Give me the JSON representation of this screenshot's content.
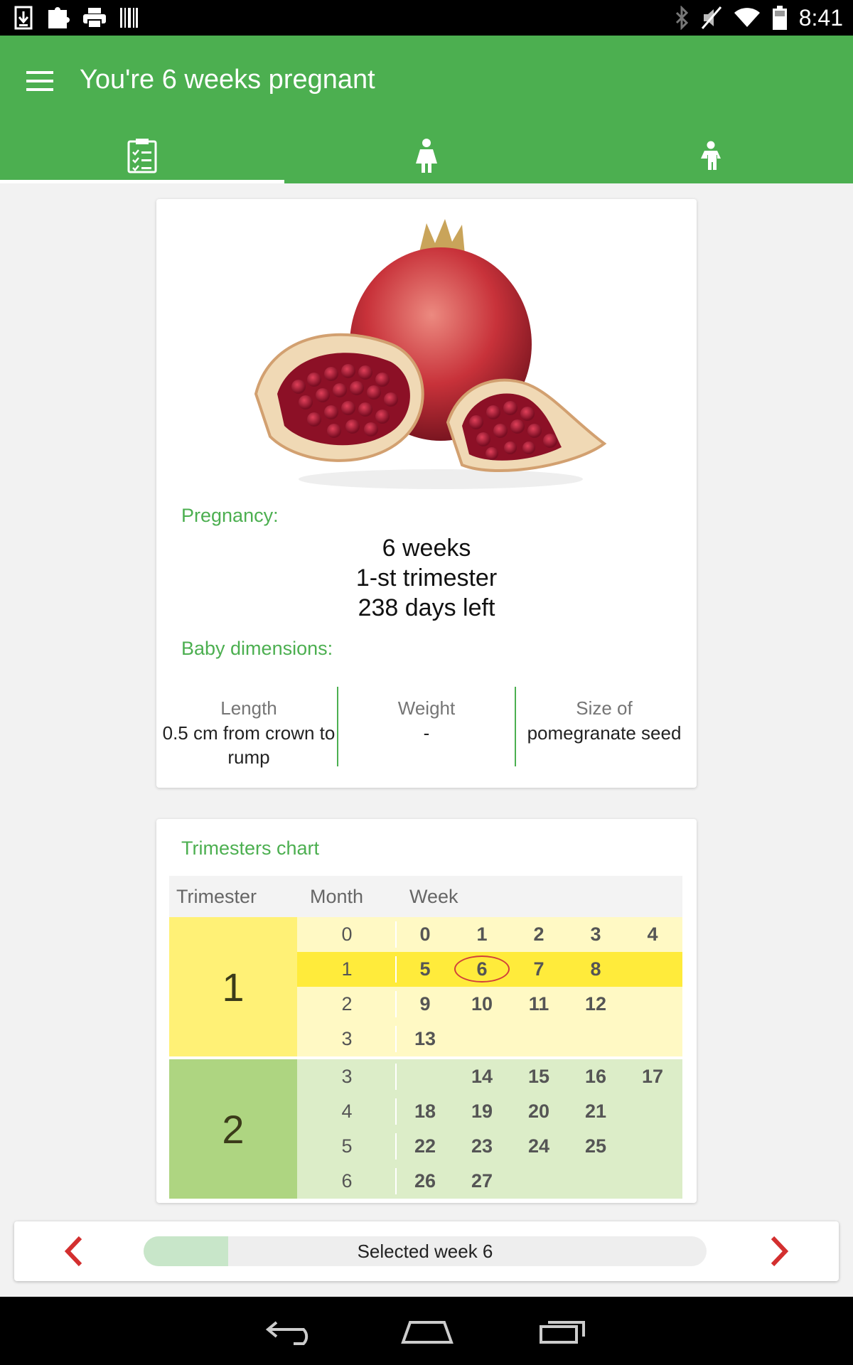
{
  "status_bar": {
    "time": "8:41",
    "left_icons": [
      "download-icon",
      "puzzle-icon",
      "print-icon",
      "barcode-icon"
    ],
    "right_icons": [
      "bluetooth-icon",
      "mute-icon",
      "wifi-icon",
      "battery-icon"
    ]
  },
  "app_bar": {
    "title": "You're 6 weeks pregnant",
    "tabs": [
      {
        "icon": "checklist-icon",
        "active": true
      },
      {
        "icon": "pregnant-woman-icon",
        "active": false
      },
      {
        "icon": "child-icon",
        "active": false
      }
    ]
  },
  "week_card": {
    "image": "pomegranate-image",
    "pregnancy_label": "Pregnancy:",
    "weeks_text": "6 weeks",
    "trimester_text": "1-st trimester",
    "days_left_text": "238 days left",
    "dimensions_label": "Baby dimensions:",
    "dimensions": [
      {
        "head": "Length",
        "value": "0.5 cm from crown to rump"
      },
      {
        "head": "Weight",
        "value": "-"
      },
      {
        "head": "Size of",
        "value": "pomegranate seed"
      }
    ]
  },
  "trimesters_chart": {
    "title": "Trimesters chart",
    "headers": {
      "trimester": "Trimester",
      "month": "Month",
      "week": "Week"
    },
    "trimesters": [
      {
        "number": "1",
        "color": "#fff176",
        "row_color": "#fff9c4",
        "rows": [
          {
            "month": "0",
            "weeks": [
              "0",
              "1",
              "2",
              "3",
              "4"
            ]
          },
          {
            "month": "1",
            "weeks": [
              "5",
              "6",
              "7",
              "8"
            ],
            "highlight": true
          },
          {
            "month": "2",
            "weeks": [
              "9",
              "10",
              "11",
              "12"
            ]
          },
          {
            "month": "3",
            "weeks": [
              "13"
            ]
          }
        ]
      },
      {
        "number": "2",
        "color": "#aed581",
        "row_color": "#dcedc8",
        "rows": [
          {
            "month": "3",
            "weeks": [
              "",
              "14",
              "15",
              "16",
              "17"
            ]
          },
          {
            "month": "4",
            "weeks": [
              "18",
              "19",
              "20",
              "21"
            ]
          },
          {
            "month": "5",
            "weeks": [
              "22",
              "23",
              "24",
              "25"
            ]
          },
          {
            "month": "6",
            "weeks": [
              "26",
              "27"
            ]
          }
        ]
      }
    ],
    "selected_week": "6",
    "highlight_row_color": "#ffeb3b"
  },
  "selector": {
    "text": "Selected week 6",
    "progress_fraction": 0.15,
    "prev_icon": "chevron-left-icon",
    "next_icon": "chevron-right-icon"
  },
  "nav_bar": {
    "icons": [
      "back-icon",
      "home-icon",
      "recents-icon"
    ]
  },
  "colors": {
    "primary": "#4caf50",
    "accent_arrow": "#d32f2f"
  }
}
